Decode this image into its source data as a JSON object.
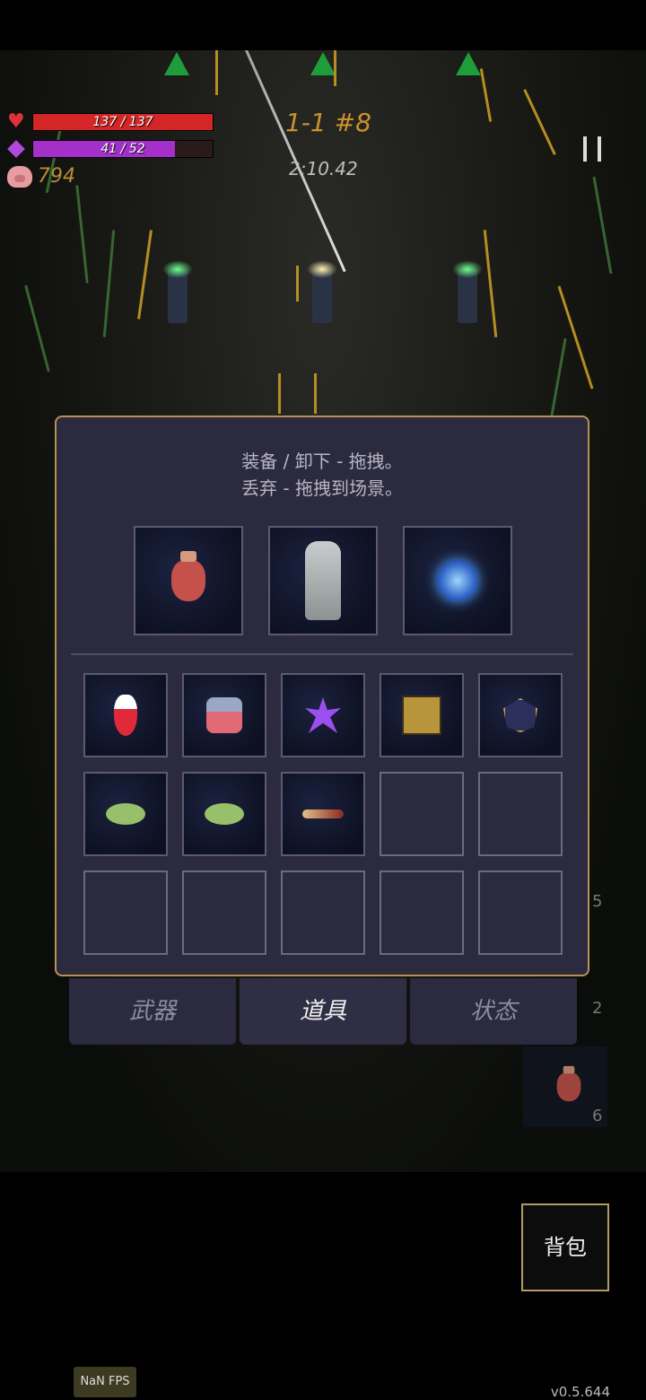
{
  "hud": {
    "hp_text": "137 / 137",
    "hp_fraction": 1.0,
    "mana_text": "41 / 52",
    "mana_fraction": 0.79,
    "coins": "794",
    "stage": "1-1 #8",
    "timer": "2:10.42",
    "colors": {
      "hp": "#d42626",
      "mana": "#a52fc9"
    }
  },
  "inventory": {
    "hint_line1": "装备 / 卸下 - 拖拽。",
    "hint_line2": "丢弃 - 拖拽到场景。",
    "equipped": [
      {
        "icon": "clay-flask-icon"
      },
      {
        "icon": "moai-statue-icon"
      },
      {
        "icon": "energy-orb-icon"
      }
    ],
    "bag_rows": [
      [
        "red-potion-icon",
        "pink-bottle-icon",
        "purple-star-icon",
        "golden-cube-icon",
        "d20-dice-icon"
      ],
      [
        "seed-pod-icon",
        "seed-pod-icon",
        "horn-icon",
        "",
        ""
      ],
      [
        "",
        "",
        "",
        "",
        ""
      ]
    ]
  },
  "tabs": [
    {
      "label": "武器",
      "active": false
    },
    {
      "label": "道具",
      "active": true
    },
    {
      "label": "状态",
      "active": false
    }
  ],
  "side": {
    "num_a": "2",
    "num_b": "6",
    "num_c": "5"
  },
  "bag_button": "背包",
  "fps": "NaN FPS",
  "version": "v0.5.644"
}
